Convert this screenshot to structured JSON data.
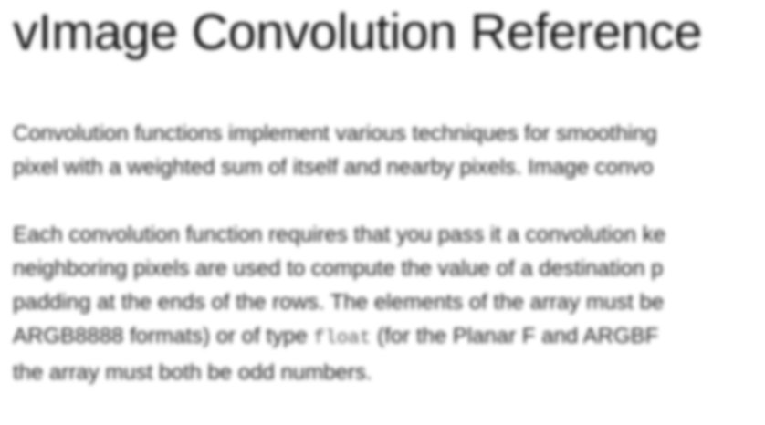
{
  "title": "vImage Convolution Reference",
  "paragraphs": [
    {
      "lines": [
        {
          "text": "Convolution functions implement various techniques for smoothing"
        },
        {
          "text": "pixel with a weighted sum of itself and nearby pixels. Image convo"
        }
      ]
    },
    {
      "lines": [
        {
          "text": "Each convolution function requires that you pass it a convolution ke"
        },
        {
          "text": "neighboring pixels are used to compute the value of a destination p"
        },
        {
          "text": "padding at the ends of the rows. The elements of the array must be"
        },
        {
          "pre": "ARGB8888 formats) or of type ",
          "code": "float",
          "post": " (for the Planar F and ARGBF"
        },
        {
          "text": "the array must both be odd numbers."
        }
      ]
    }
  ]
}
